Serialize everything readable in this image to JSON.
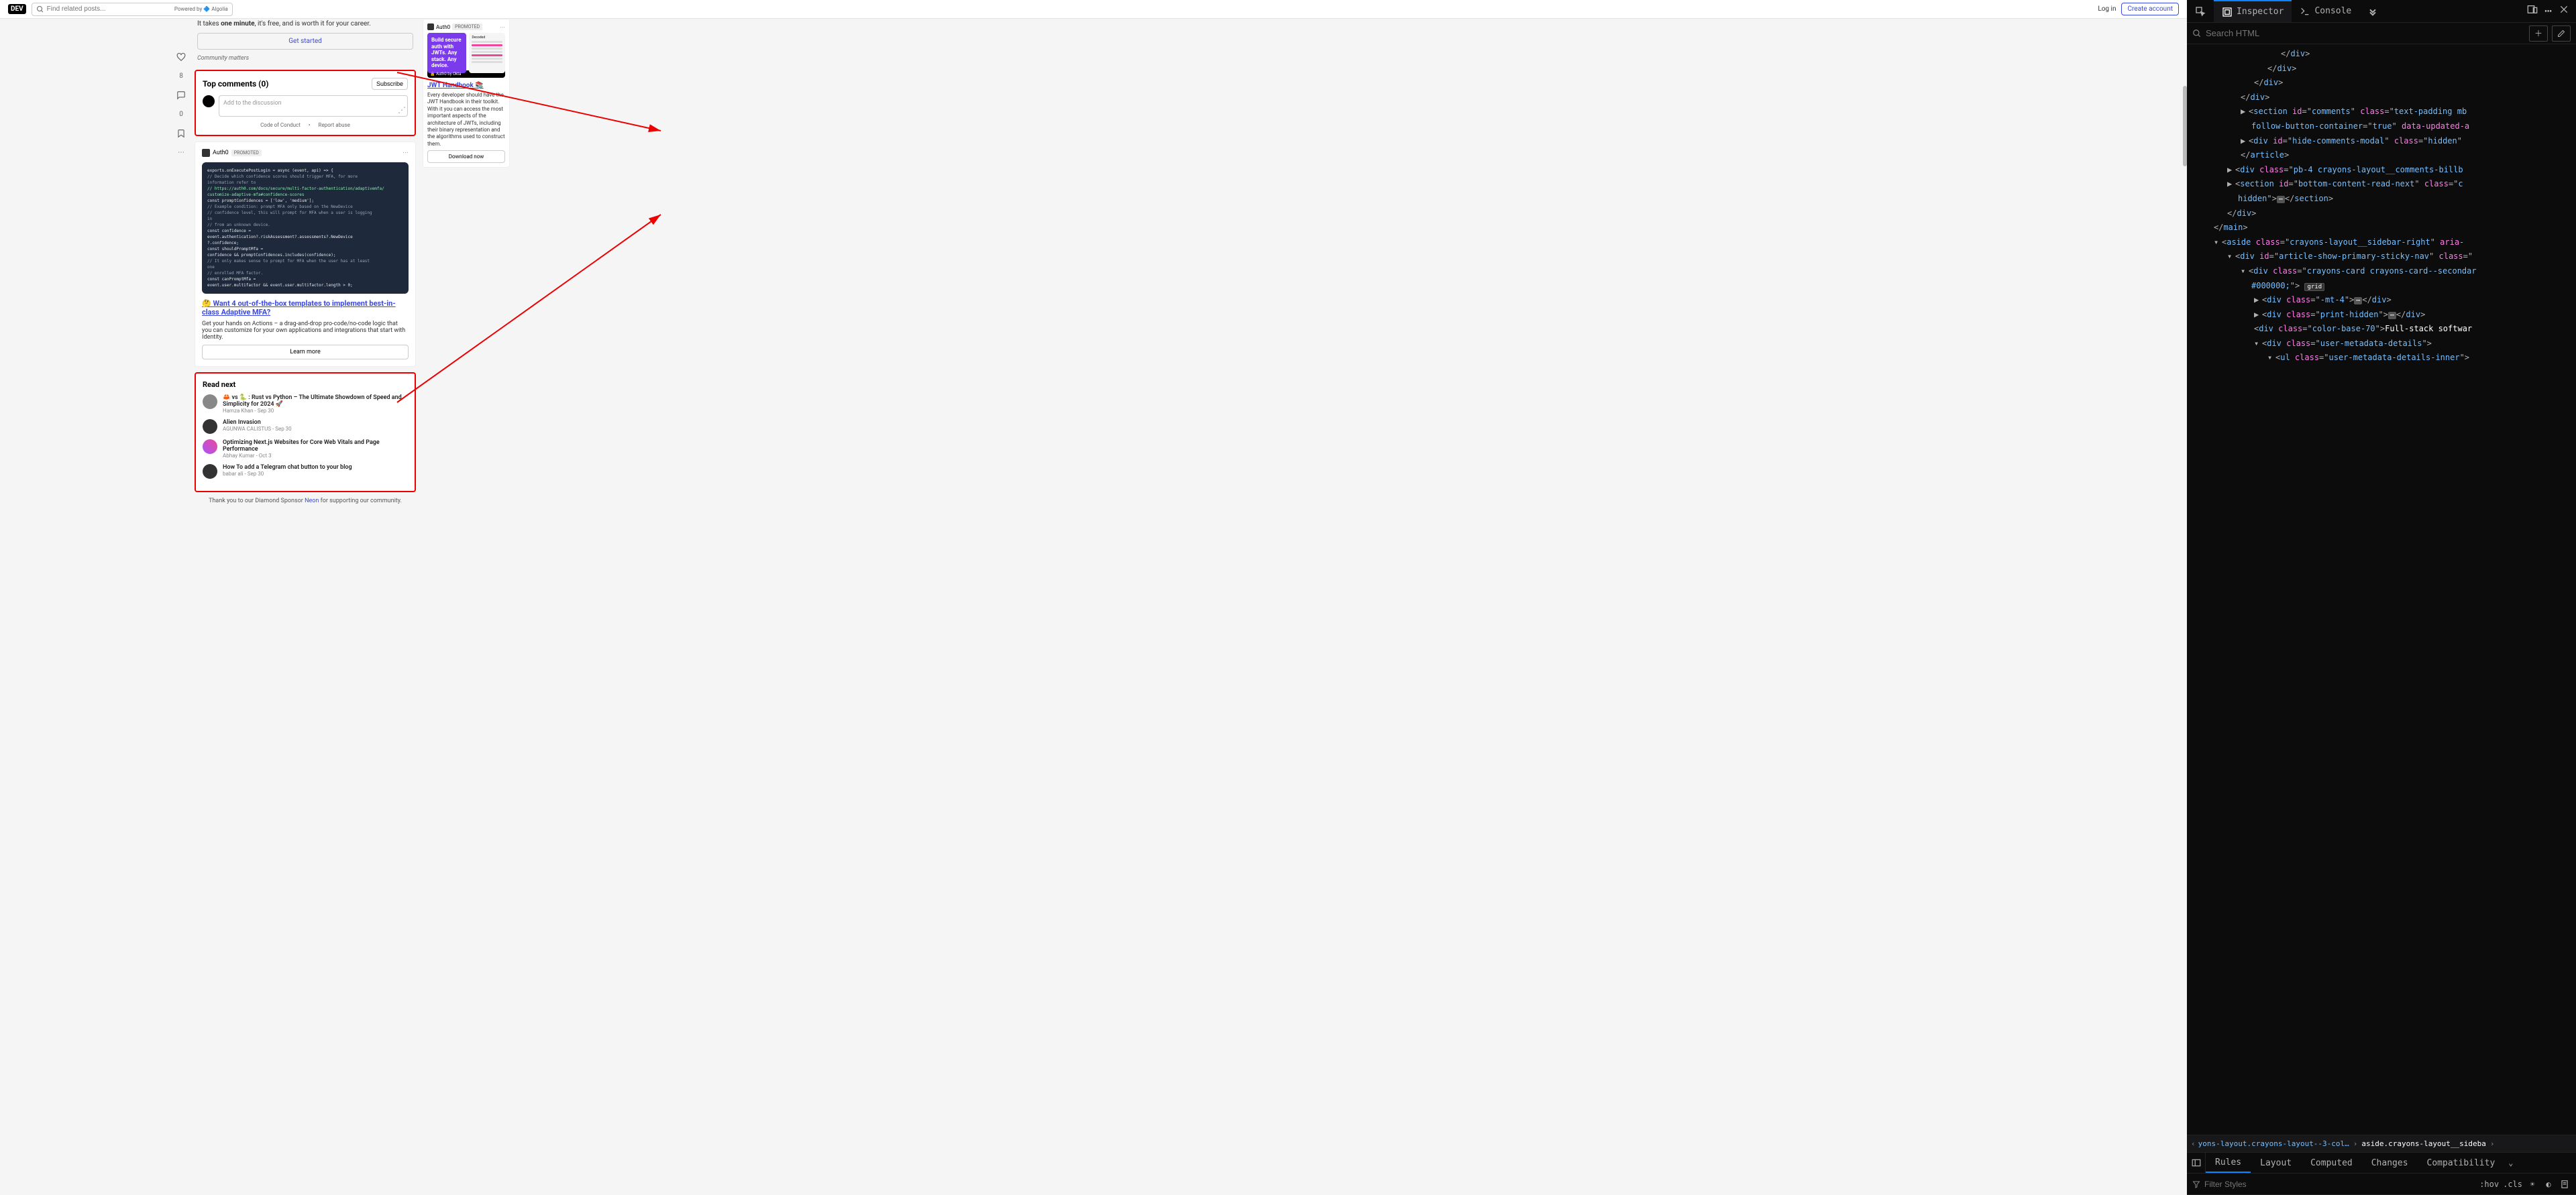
{
  "header": {
    "logo": "DEV",
    "search_placeholder": "Find related posts...",
    "algolia": "Powered by 🔷 Algolia",
    "login": "Log in",
    "create": "Create account"
  },
  "rail": {
    "count": "8",
    "zero": "0"
  },
  "one_min": {
    "prefix": "It takes ",
    "bold": "one minute",
    "suffix": ", it's free, and is worth it for your career.",
    "btn": "Get started",
    "note": "Community matters"
  },
  "comments": {
    "title": "Top comments (0)",
    "subscribe": "Subscribe",
    "placeholder": "Add to the discussion",
    "coc": "Code of Conduct",
    "report": "Report abuse"
  },
  "promo1": {
    "brand": "Auth0",
    "badge": "PROMOTED",
    "title_pre": "🤔 ",
    "title": "Want 4 out-of-the-box templates to implement best-in-class Adaptive MFA?",
    "desc": "Get your hands on Actions – a drag-and-drop pro-code/no-code logic that you can customize for your own applications and integrations that start with Identity.",
    "btn": "Learn more",
    "code": [
      {
        "cls": "c-white",
        "t": "exports.onExecutePostLogin = async (event, api) => {"
      },
      {
        "cls": "c-gray",
        "t": "// Decide which confidence scores should trigger MFA, for more"
      },
      {
        "cls": "c-gray",
        "t": "information refer to"
      },
      {
        "cls": "c-green",
        "t": "// https://auth0.com/docs/secure/multi-factor-authentication/adaptivemfa/"
      },
      {
        "cls": "c-green",
        "t": "customize-adaptive-mfa#confidence-scores"
      },
      {
        "cls": "c-white",
        "t": "const promptConfidences = ['low', 'medium'];"
      },
      {
        "cls": "c-white",
        "t": ""
      },
      {
        "cls": "c-gray",
        "t": "// Example condition: prompt MFA only based on the NewDevice"
      },
      {
        "cls": "c-gray",
        "t": "// confidence level, this will prompt for MFA when a user is logging"
      },
      {
        "cls": "c-gray",
        "t": "in"
      },
      {
        "cls": "c-gray",
        "t": "// from an unknown device."
      },
      {
        "cls": "c-white",
        "t": "const confidence ="
      },
      {
        "cls": "c-white",
        "t": "event.authentication?.riskAssessment?.assessments?.NewDevice"
      },
      {
        "cls": "c-white",
        "t": "?.confidence;"
      },
      {
        "cls": "c-white",
        "t": "const shouldPromptMfa ="
      },
      {
        "cls": "c-white",
        "t": "confidence && promptConfidences.includes(confidence);"
      },
      {
        "cls": "c-white",
        "t": ""
      },
      {
        "cls": "c-gray",
        "t": "// It only makes sense to prompt for MFA when the user has at least"
      },
      {
        "cls": "c-gray",
        "t": "one"
      },
      {
        "cls": "c-gray",
        "t": "// enrolled MFA factor."
      },
      {
        "cls": "c-white",
        "t": "const canPromptMfa ="
      },
      {
        "cls": "c-white",
        "t": "event.user.multifactor && event.user.multifactor.length > 0;"
      }
    ]
  },
  "read_next": {
    "title": "Read next",
    "items": [
      {
        "title": "🦀 vs 🐍 : Rust vs Python – The Ultimate Showdown of Speed and Simplicity for 2024 🚀",
        "meta": "Hamza Khan - Sep 30"
      },
      {
        "title": "Alien Invasion",
        "meta": "AGUNWA CALISTUS - Sep 30"
      },
      {
        "title": "Optimizing Next.js Websites for Core Web Vitals and Page Performance",
        "meta": "Abhay Kumar - Oct 3"
      },
      {
        "title": "How To add a Telegram chat button to your blog",
        "meta": "babar ali - Sep 30"
      }
    ]
  },
  "sidebar": {
    "brand": "Auth0",
    "badge": "PROMOTED",
    "jwt_text": "Build secure auth with JWTs. Any stack. Any device.",
    "jwt_footer": "🔒 Auth0 by Okta",
    "decoded_label": "Decoded",
    "title": "JWT Handbook 📚",
    "desc": "Every developer should have the JWT Handbook in their toolkit. With it you can access the most important aspects of the architecture of JWTs, including their binary representation and the algorithms used to construct them.",
    "btn": "Download now"
  },
  "footer": {
    "pre": "Thank you to our Diamond Sponsor ",
    "link": "Neon",
    "post": " for supporting our community."
  },
  "devtools": {
    "tabs": {
      "inspector": "Inspector",
      "console": "Console"
    },
    "search_ph": "Search HTML",
    "tree": {
      "close_div": "div",
      "sect1_l1": "<section id=\"comments\" class=\"text-padding mb",
      "sect1_l2": "follow-button-container=\"true\" data-updated-a",
      "hide_div": "<div id=\"hide-comments-modal\" class=\"hidden\"",
      "close_article": "article",
      "billboard": "<div class=\"pb-4 crayons-layout__comments-billb",
      "sect2_l1": "<section id=\"bottom-content-read-next\" class=\"c",
      "sect2_l2": "hidden\">",
      "close_section": "section",
      "close_main": "main",
      "aside": "<aside class=\"crayons-layout__sidebar-right\" aria-",
      "sticky": "<div id=\"article-show-primary-sticky-nav\" class=\"",
      "secondary_l1": "<div class=\"crayons-card crayons-card--secondar",
      "secondary_l2": "#000000;\">",
      "mt4": "<div class=\"-mt-4\">",
      "print_hidden": "<div class=\"print-hidden\">",
      "color_base_pre": "<div class=\"color-base-70\">",
      "color_base_text": "Full-stack softwar",
      "meta_div": "<div class=\"user-metadata-details\">",
      "meta_ul": "<ul class=\"user-metadata-details-inner\">"
    },
    "breadcrumb": {
      "c1": "yons-layout.crayons-layout--3-col…",
      "c2": "aside.crayons-layout__sideba"
    },
    "subtabs": {
      "rules": "Rules",
      "layout": "Layout",
      "computed": "Computed",
      "changes": "Changes",
      "compat": "Compatibility"
    },
    "filter_ph": "Filter Styles",
    "hov": ":hov",
    "cls": ".cls",
    "grid_badge": "grid"
  }
}
